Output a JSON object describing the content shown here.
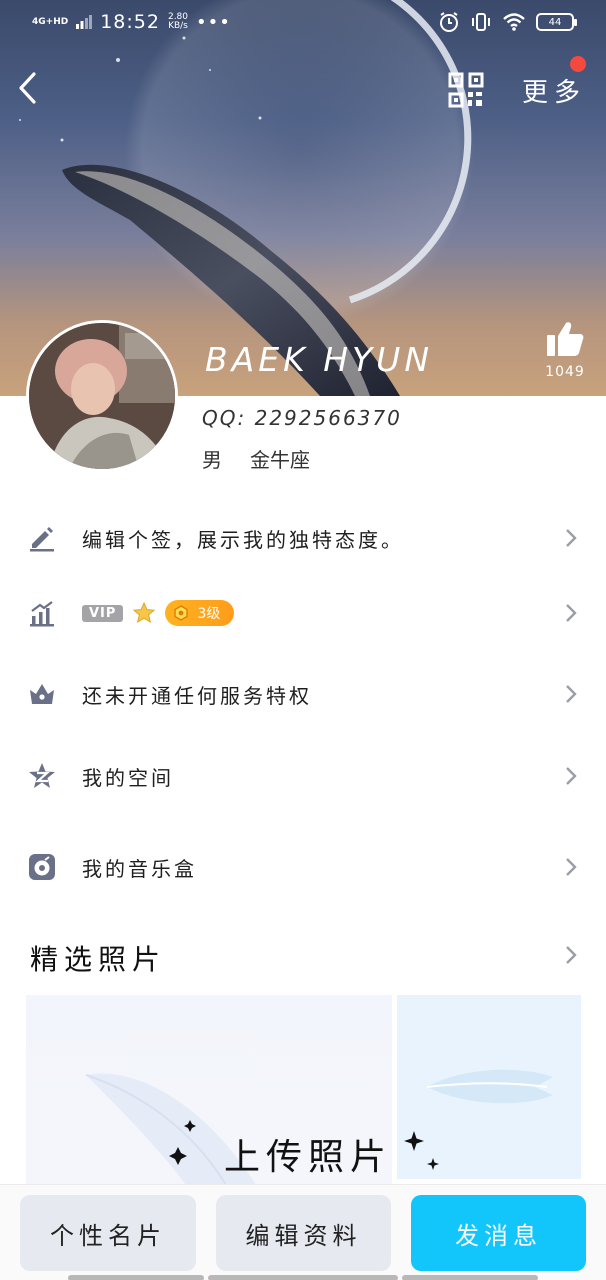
{
  "status_bar": {
    "network": "4G+HD",
    "time": "18:52",
    "speed_value": "2.80",
    "speed_unit": "KB/s",
    "overflow": "•••",
    "battery": "44"
  },
  "header": {
    "more_label": "更多",
    "nickname": "BAEK HYUN",
    "like_count": "1049"
  },
  "profile": {
    "qq_label": "QQ:",
    "qq_number": "2292566370",
    "gender": "男",
    "zodiac": "金牛座"
  },
  "rows": {
    "signature": "编辑个签，展示我的独特态度。",
    "vip_tag": "VIP",
    "level": "3级",
    "privilege": "还未开通任何服务特权",
    "qzone": "我的空间",
    "music": "我的音乐盒"
  },
  "photos": {
    "title": "精选照片",
    "upload_label": "上传照片"
  },
  "bottom": {
    "card_label": "个性名片",
    "edit_label": "编辑资料",
    "message_label": "发消息"
  },
  "colors": {
    "accent_blue": "#12c6fb",
    "level_orange": "#ffa41c",
    "notify_red": "#f4493f"
  }
}
